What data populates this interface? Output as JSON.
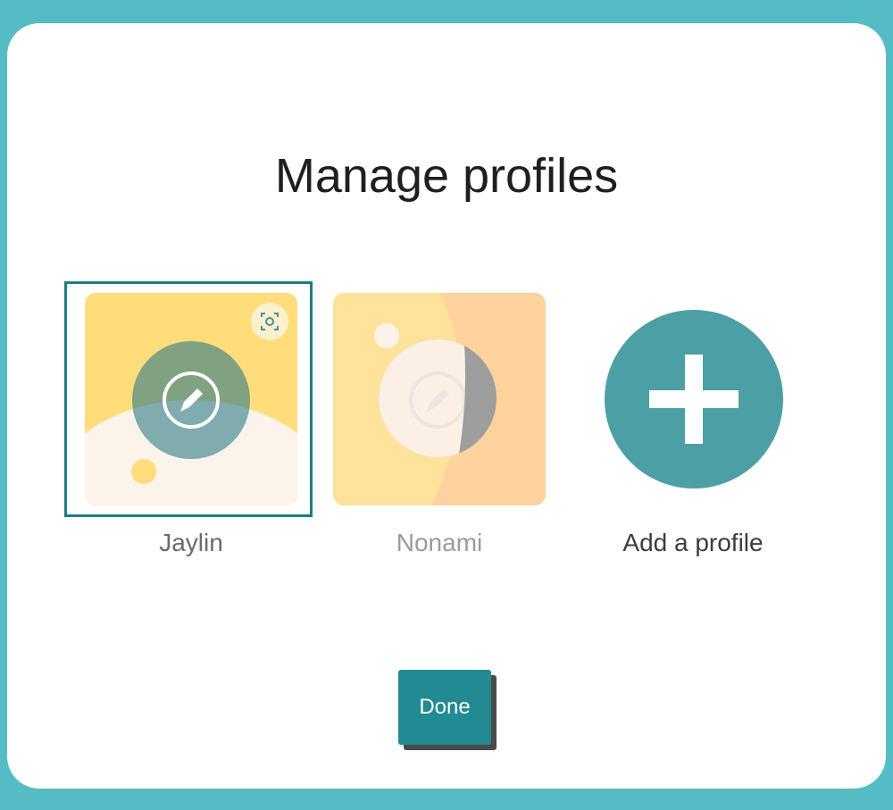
{
  "dialog": {
    "title": "Manage profiles"
  },
  "profiles": [
    {
      "name": "Jaylin",
      "selected": true,
      "overlay_icon": "pencil-icon",
      "corner_icon": "face-scan-icon"
    },
    {
      "name": "Nonami",
      "selected": false,
      "overlay_icon": "pencil-icon"
    }
  ],
  "add_profile": {
    "label": "Add a profile",
    "icon": "plus-icon"
  },
  "footer": {
    "done_label": "Done"
  },
  "colors": {
    "background": "#55bcc5",
    "accent": "#228a92",
    "add_circle": "#4d9fa6",
    "card_yellow": "#ffdd7a",
    "card_cream": "#fcf3ea",
    "card_peach": "#ffd29e"
  }
}
